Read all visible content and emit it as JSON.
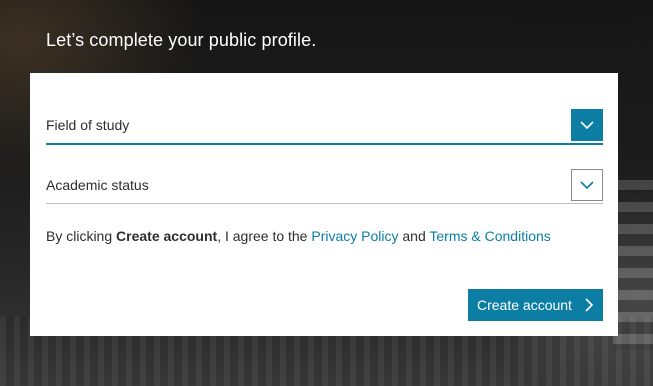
{
  "headline": "Let’s complete your public profile.",
  "form": {
    "field_of_study": {
      "placeholder": "Field of study",
      "icon": "chevron-down-icon"
    },
    "academic_status": {
      "placeholder": "Academic status",
      "icon": "chevron-down-icon"
    }
  },
  "agreement": {
    "prefix": "By clicking ",
    "bold": "Create account",
    "middle": ", I agree to the ",
    "privacy_link": "Privacy Policy",
    "and": " and ",
    "terms_link": "Terms & Conditions"
  },
  "buttons": {
    "create_account": "Create account",
    "create_account_icon": "chevron-right-icon"
  },
  "colors": {
    "accent": "#0c7da3",
    "card_background": "#ffffff",
    "text": "#2e2e2e"
  }
}
